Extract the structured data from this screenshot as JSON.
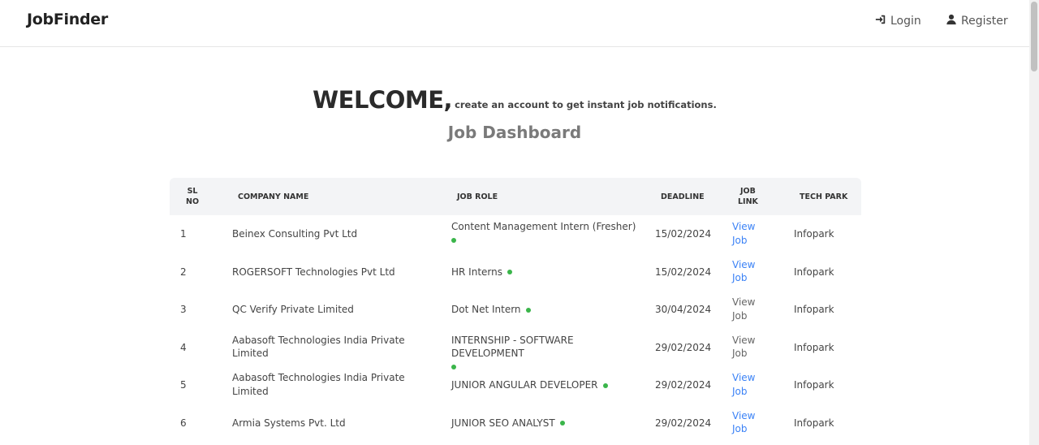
{
  "nav": {
    "brand": "JobFinder",
    "login_label": "Login",
    "register_label": "Register"
  },
  "hero": {
    "welcome": "WELCOME,",
    "subtitle": "create an account to get instant job notifications.",
    "dashboard_title": "Job Dashboard"
  },
  "table": {
    "headers": {
      "sl": [
        "SL",
        "NO"
      ],
      "company": "COMPANY NAME",
      "role": "JOB ROLE",
      "deadline": "DEADLINE",
      "link": [
        "JOB",
        "LINK"
      ],
      "park": "TECH PARK"
    },
    "rows": [
      {
        "sl": "1",
        "company": "Beinex Consulting Pvt Ltd",
        "role": "Content Management Intern (Fresher)",
        "deadline": "15/02/2024",
        "link": "View Job",
        "link_style": "blue",
        "park": "Infopark"
      },
      {
        "sl": "2",
        "company": "ROGERSOFT Technologies Pvt Ltd",
        "role": "HR Interns",
        "deadline": "15/02/2024",
        "link": "View Job",
        "link_style": "blue",
        "park": "Infopark"
      },
      {
        "sl": "3",
        "company": "QC Verify Private Limited",
        "role": "Dot Net Intern",
        "deadline": "30/04/2024",
        "link": "View Job",
        "link_style": "gray",
        "park": "Infopark"
      },
      {
        "sl": "4",
        "company": "Aabasoft Technologies India Private Limited",
        "role": "INTERNSHIP - SOFTWARE DEVELOPMENT",
        "deadline": "29/02/2024",
        "link": "View Job",
        "link_style": "gray",
        "park": "Infopark"
      },
      {
        "sl": "5",
        "company": "Aabasoft Technologies India Private Limited",
        "role": "JUNIOR ANGULAR DEVELOPER",
        "deadline": "29/02/2024",
        "link": "View Job",
        "link_style": "blue",
        "park": "Infopark"
      },
      {
        "sl": "6",
        "company": "Armia Systems Pvt. Ltd",
        "role": "JUNIOR SEO ANALYST",
        "deadline": "29/02/2024",
        "link": "View Job",
        "link_style": "blue",
        "park": "Infopark"
      }
    ]
  },
  "colors": {
    "active_dot": "#3ab54a",
    "link_blue": "#3b82f6",
    "link_gray": "#666666"
  },
  "icons": {
    "login": "sign-in-icon",
    "register": "user-icon"
  }
}
